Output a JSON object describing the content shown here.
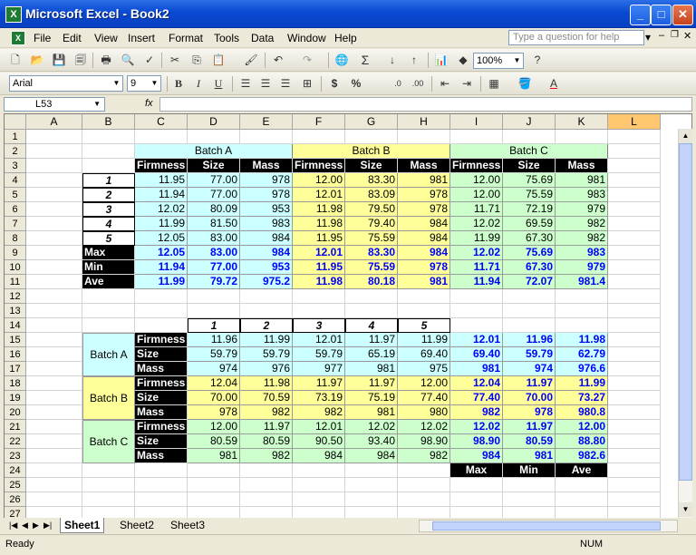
{
  "window": {
    "title": "Microsoft Excel - Book2"
  },
  "menu": [
    "File",
    "Edit",
    "View",
    "Insert",
    "Format",
    "Tools",
    "Data",
    "Window",
    "Help"
  ],
  "help_box": {
    "placeholder": "Type a question for help"
  },
  "toolbar": {
    "zoom": "100%"
  },
  "format_toolbar": {
    "font": "Arial",
    "size": "9",
    "bold": "B",
    "italic": "I",
    "underline": "U",
    "currency": "$",
    "percent": "%"
  },
  "formula_bar": {
    "name_box": "L53",
    "fx": "fx",
    "value": ""
  },
  "columns": [
    "A",
    "B",
    "C",
    "D",
    "E",
    "F",
    "G",
    "H",
    "I",
    "J",
    "K",
    "L"
  ],
  "rows": [
    "1",
    "2",
    "3",
    "4",
    "5",
    "6",
    "7",
    "8",
    "9",
    "10",
    "11",
    "12",
    "13",
    "14",
    "15",
    "16",
    "17",
    "18",
    "19",
    "20",
    "21",
    "22",
    "23",
    "24",
    "25",
    "26",
    "27"
  ],
  "table1": {
    "batch_headers": [
      "Batch A",
      "Batch B",
      "Batch C"
    ],
    "sub_headers": [
      "Firmness",
      "Size",
      "Mass",
      "Firmness",
      "Size",
      "Mass",
      "Firmness",
      "Size",
      "Mass"
    ],
    "row_labels": [
      "1",
      "2",
      "3",
      "4",
      "5"
    ],
    "data": [
      [
        "11.95",
        "77.00",
        "978",
        "12.00",
        "83.30",
        "981",
        "12.00",
        "75.69",
        "981"
      ],
      [
        "11.94",
        "77.00",
        "978",
        "12.01",
        "83.09",
        "978",
        "12.00",
        "75.59",
        "983"
      ],
      [
        "12.02",
        "80.09",
        "953",
        "11.98",
        "79.50",
        "978",
        "11.71",
        "72.19",
        "979"
      ],
      [
        "11.99",
        "81.50",
        "983",
        "11.98",
        "79.40",
        "984",
        "12.02",
        "69.59",
        "982"
      ],
      [
        "12.05",
        "83.00",
        "984",
        "11.95",
        "75.59",
        "984",
        "11.99",
        "67.30",
        "982"
      ]
    ],
    "stat_labels": [
      "Max",
      "Min",
      "Ave"
    ],
    "stats": [
      [
        "12.05",
        "83.00",
        "984",
        "12.01",
        "83.30",
        "984",
        "12.02",
        "75.69",
        "983"
      ],
      [
        "11.94",
        "77.00",
        "953",
        "11.95",
        "75.59",
        "978",
        "11.71",
        "67.30",
        "979"
      ],
      [
        "11.99",
        "79.72",
        "975.2",
        "11.98",
        "80.18",
        "981",
        "11.94",
        "72.07",
        "981.4"
      ]
    ]
  },
  "table2": {
    "col_headers": [
      "1",
      "2",
      "3",
      "4",
      "5"
    ],
    "batch_labels": [
      "Batch A",
      "Batch B",
      "Batch C"
    ],
    "measure_labels": [
      "Firmness",
      "Size",
      "Mass"
    ],
    "data": [
      [
        "11.96",
        "11.99",
        "12.01",
        "11.97",
        "11.99"
      ],
      [
        "59.79",
        "59.79",
        "59.79",
        "65.19",
        "69.40"
      ],
      [
        "974",
        "976",
        "977",
        "981",
        "975"
      ],
      [
        "12.04",
        "11.98",
        "11.97",
        "11.97",
        "12.00"
      ],
      [
        "70.00",
        "70.59",
        "73.19",
        "75.19",
        "77.40"
      ],
      [
        "978",
        "982",
        "982",
        "981",
        "980"
      ],
      [
        "12.00",
        "11.97",
        "12.01",
        "12.02",
        "12.02"
      ],
      [
        "80.59",
        "80.59",
        "90.50",
        "93.40",
        "98.90"
      ],
      [
        "981",
        "982",
        "984",
        "984",
        "982"
      ]
    ],
    "stats": [
      [
        "12.01",
        "11.96",
        "11.98"
      ],
      [
        "69.40",
        "59.79",
        "62.79"
      ],
      [
        "981",
        "974",
        "976.6"
      ],
      [
        "12.04",
        "11.97",
        "11.99"
      ],
      [
        "77.40",
        "70.00",
        "73.27"
      ],
      [
        "982",
        "978",
        "980.8"
      ],
      [
        "12.02",
        "11.97",
        "12.00"
      ],
      [
        "98.90",
        "80.59",
        "88.80"
      ],
      [
        "984",
        "981",
        "982.6"
      ]
    ],
    "stat_labels": [
      "Max",
      "Min",
      "Ave"
    ]
  },
  "sheet_tabs": [
    "Sheet1",
    "Sheet2",
    "Sheet3"
  ],
  "status": {
    "left": "Ready",
    "num": "NUM"
  }
}
